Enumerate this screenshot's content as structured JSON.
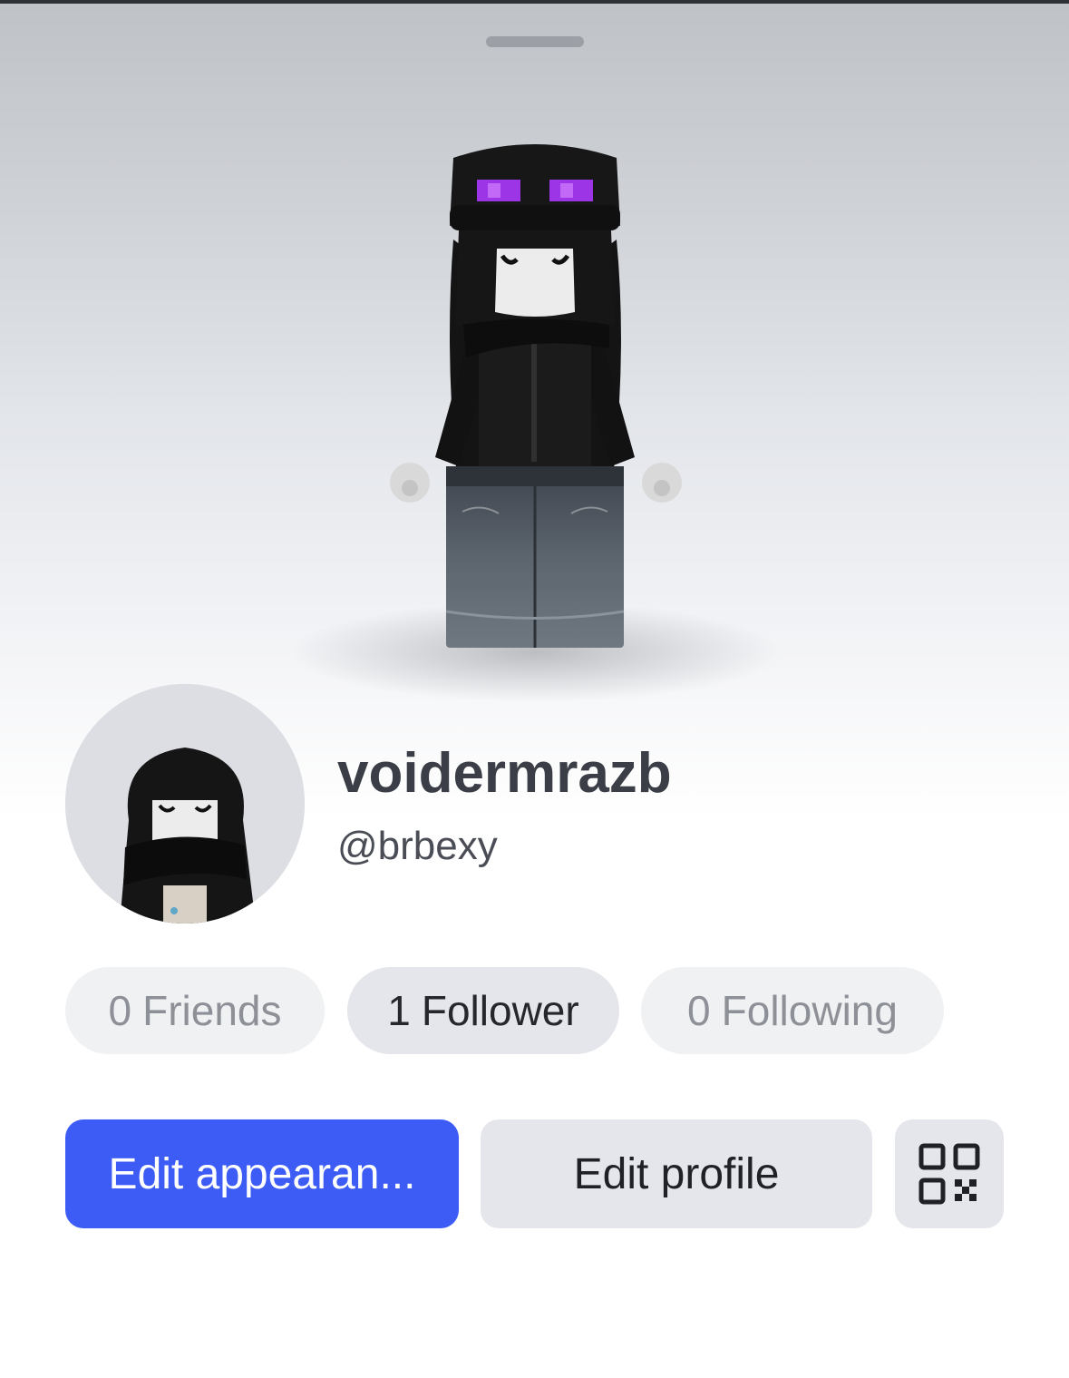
{
  "profile": {
    "display_name": "voidermrazb",
    "username": "@brbexy"
  },
  "stats": {
    "friends": {
      "count": "0",
      "label": "Friends"
    },
    "followers": {
      "count": "1",
      "label": "Follower"
    },
    "following": {
      "count": "0",
      "label": "Following"
    }
  },
  "actions": {
    "edit_appearance_label": "Edit appearan...",
    "edit_profile_label": "Edit profile",
    "qr_icon": "qr-code-icon"
  },
  "colors": {
    "primary_button": "#3c5cf5",
    "secondary_button": "#e4e6eb",
    "eye_glow": "#9b35e6"
  }
}
